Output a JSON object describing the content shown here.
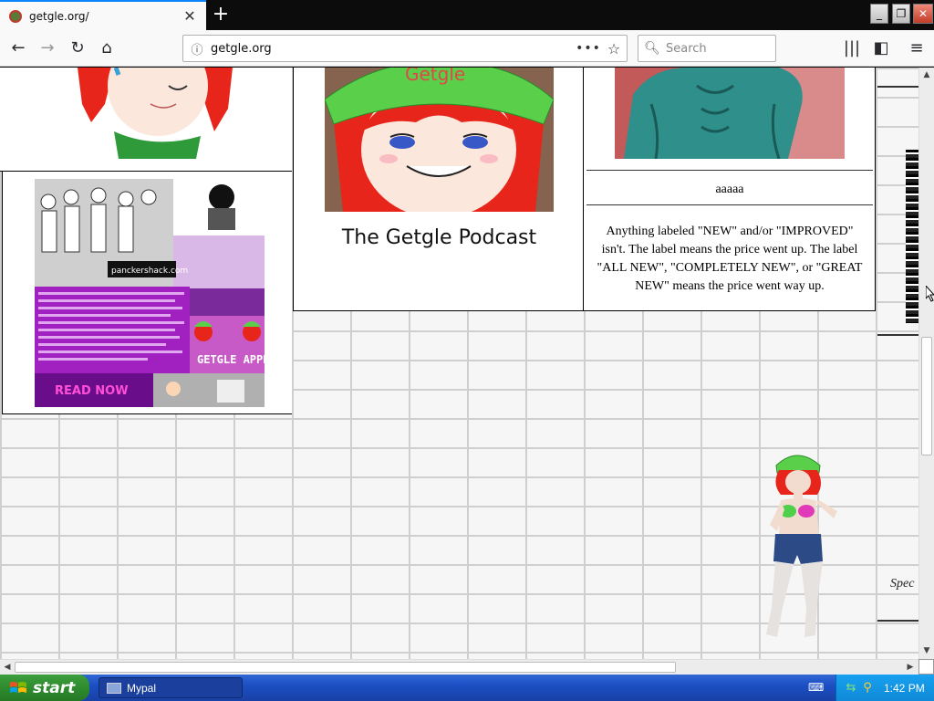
{
  "browser": {
    "tab_title": "getgle.org/",
    "url": "getgle.org",
    "search_placeholder": "Search",
    "new_tab_label": "+",
    "close_tab_label": "✕"
  },
  "page": {
    "podcast_title": "The Getgle Podcast",
    "podcast_cap_text": "Getgle",
    "comic_site": "panckershack.com",
    "comic_approves": "GETGLE APPROVES",
    "comic_read_now": "READ NOW",
    "right_name": "aaaaa",
    "right_quote": "Anything labeled \"NEW\" and/or \"IMPROVED\" isn't. The label means the price went up. The label \"ALL NEW\", \"COMPLETELY NEW\", or \"GREAT NEW\" means the price went way up.",
    "far_right_text": "Spec"
  },
  "taskbar": {
    "start_label": "start",
    "task_label": "Mypal",
    "clock": "1:42 PM"
  },
  "colors": {
    "firefox_blue": "#0a84ff",
    "xp_blue": "#1c4fc4",
    "xp_green": "#2e8b2e",
    "cap_green": "#5ad04a",
    "hair_red": "#e8251a"
  }
}
